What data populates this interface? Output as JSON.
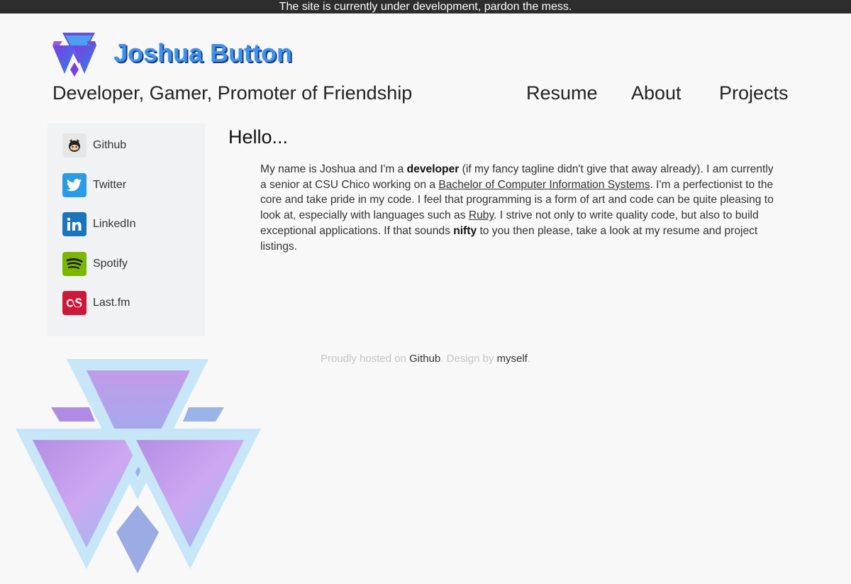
{
  "banner": {
    "text": "The site is currently under development, pardon the mess."
  },
  "header": {
    "title": "Joshua Button",
    "tagline": "Developer, Gamer, Promoter of Friendship",
    "nav": [
      {
        "label": "Resume"
      },
      {
        "label": "About"
      },
      {
        "label": "Projects"
      }
    ]
  },
  "sidebar": {
    "items": [
      {
        "label": "Github",
        "icon": "github-icon"
      },
      {
        "label": "Twitter",
        "icon": "twitter-icon"
      },
      {
        "label": "LinkedIn",
        "icon": "linkedin-icon"
      },
      {
        "label": "Spotify",
        "icon": "spotify-icon"
      },
      {
        "label": "Last.fm",
        "icon": "lastfm-icon"
      }
    ]
  },
  "main": {
    "heading": "Hello...",
    "intro": {
      "p1": "My name is Joshua and I'm a ",
      "b1": "developer",
      "p2": " (if my fancy tagline didn't give that away already). I am currently a senior at CSU Chico working on a ",
      "link1": "Bachelor of Computer Information Systems",
      "p3": ". I'm a perfectionist to the core and take pride in my code. I feel that programming is a form of art and code can be quite pleasing to look at, especially with languages such as ",
      "link2": "Ruby",
      "p4": ". I strive not only to write quality code, but also to build exceptional applications. If that sounds ",
      "b2": "nifty",
      "p5": " to you then please, take a look at my resume and project listings."
    }
  },
  "footer": {
    "t1": "Proudly hosted on ",
    "link1": "Github",
    "t2": ". Design by ",
    "link2": "myself",
    "t3": "."
  },
  "colors": {
    "banner_bg": "#2d2d2d",
    "title": "#3f92ec",
    "title_shadow": "#1c3d80",
    "twitter": "#2b9be8",
    "linkedin": "#1b75bb",
    "spotify": "#7ab800",
    "lastfm": "#cc1839"
  }
}
